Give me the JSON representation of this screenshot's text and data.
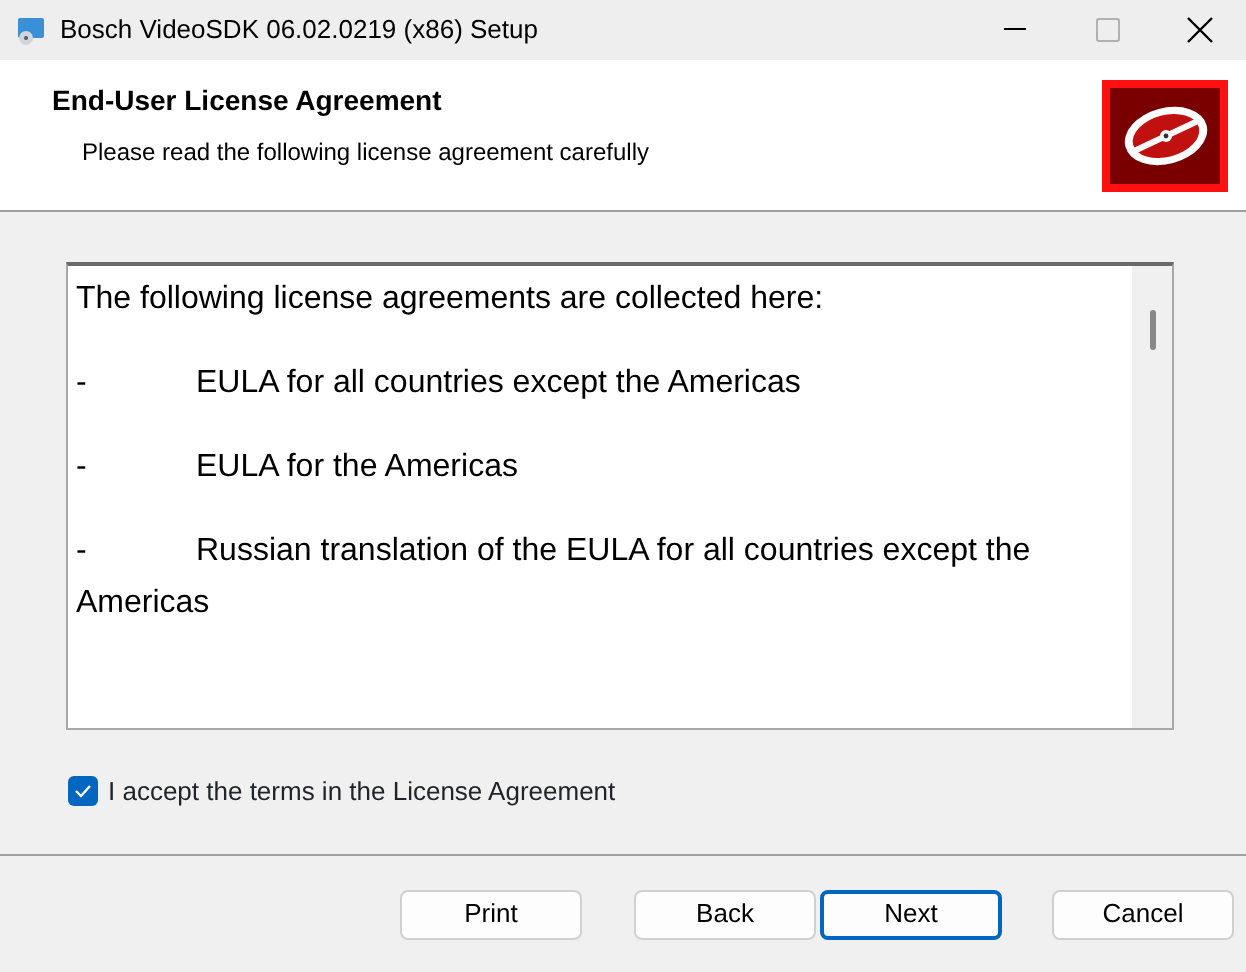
{
  "window": {
    "title": "Bosch VideoSDK 06.02.0219 (x86) Setup"
  },
  "header": {
    "title": "End-User License Agreement",
    "subtitle": "Please read the following license agreement carefully"
  },
  "license": {
    "intro": "The following license agreements are collected here:",
    "items": [
      {
        "bullet": "-",
        "text": "EULA for all countries except the Americas"
      },
      {
        "bullet": "-",
        "text": "EULA for the Americas"
      },
      {
        "bullet": "-",
        "text": "Russian translation of the EULA for all countries except the Americas"
      }
    ]
  },
  "accept": {
    "label": "I accept the terms in the License Agreement",
    "checked": true
  },
  "buttons": [
    {
      "label": "Print",
      "focused": false
    },
    {
      "label": "Back",
      "focused": false
    },
    {
      "label": "Next",
      "focused": true
    },
    {
      "label": "Cancel",
      "focused": false
    }
  ]
}
